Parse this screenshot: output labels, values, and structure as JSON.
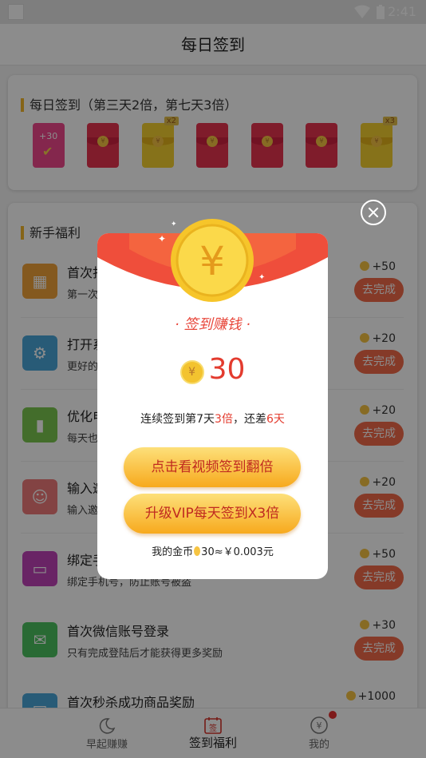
{
  "status_bar": {
    "time": "2:41"
  },
  "header": {
    "title": "每日签到"
  },
  "checkin_section": {
    "title": "每日签到（第三天2倍，第七天3倍）",
    "first_reward": "+30",
    "multiplier_day3": "x2",
    "multiplier_day7": "x3",
    "currency_symbol": "¥"
  },
  "newbie_section": {
    "title": "新手福利"
  },
  "tasks": [
    {
      "title": "首次打",
      "desc": "第一次",
      "reward": "+50",
      "button": "去完成",
      "icon": "calendar-icon",
      "color": "#f0a23a"
    },
    {
      "title": "打开系",
      "desc": "更好的",
      "reward": "+20",
      "button": "去完成",
      "icon": "settings-icon",
      "color": "#4aa6d9"
    },
    {
      "title": "优化电",
      "desc": "每天也",
      "reward": "+20",
      "button": "去完成",
      "icon": "battery-icon",
      "color": "#7ac74f"
    },
    {
      "title": "输入邀",
      "desc": "输入邀",
      "reward": "+20",
      "button": "去完成",
      "icon": "add-user-icon",
      "color": "#ee7a7a"
    },
    {
      "title": "绑定手",
      "desc": "绑定手机号，防止账号被盗",
      "reward": "+50",
      "button": "去完成",
      "icon": "tablet-icon",
      "color": "#c042b8"
    },
    {
      "title": "首次微信账号登录",
      "desc": "只有完成登陆后才能获得更多奖励",
      "reward": "+30",
      "button": "去完成",
      "icon": "wechat-icon",
      "color": "#4bc160"
    },
    {
      "title": "首次秒杀成功商品奖励",
      "desc": "",
      "reward": "+1000",
      "button": "",
      "icon": "shopping-bag-icon",
      "color": "#4aa6d9"
    }
  ],
  "tabs": [
    {
      "label": "早起赚赚",
      "icon": "moon-icon"
    },
    {
      "label": "签到福利",
      "icon": "checkin-calendar-icon",
      "icon_text": "签"
    },
    {
      "label": "我的",
      "icon": "yen-icon"
    }
  ],
  "modal": {
    "subtitle": "· 签到赚钱 ·",
    "amount": "30",
    "streak_prefix": "连续签到第7天",
    "streak_multiplier": "3倍",
    "streak_middle": "，还差",
    "streak_remaining": "6天",
    "button_primary": "点击看视频签到翻倍",
    "button_secondary": "升级VIP每天签到X3倍",
    "footer_prefix": "我的金币",
    "footer_suffix": "30≈￥0.003元",
    "coin_symbol": "¥"
  },
  "colors": {
    "accent_red": "#e33b2e",
    "gold": "#f5c02f",
    "button_orange": "#f36b4a"
  }
}
